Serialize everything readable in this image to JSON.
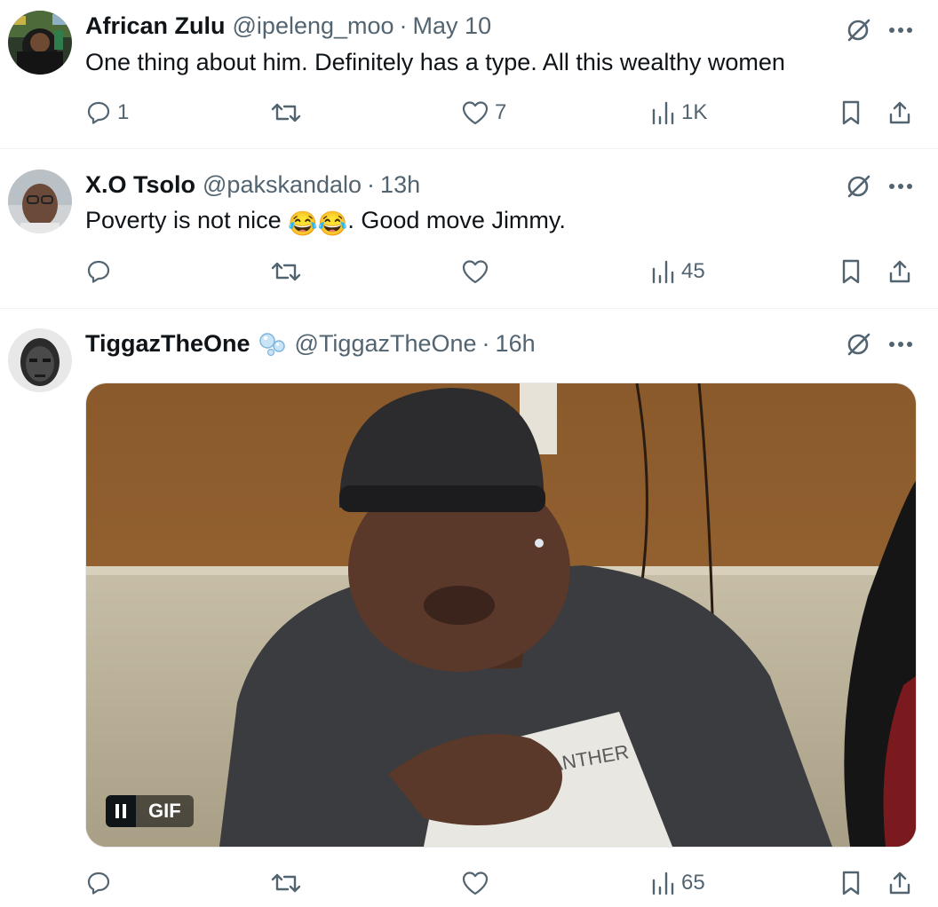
{
  "tweets": [
    {
      "name": "African Zulu",
      "handle": "@ipeleng_moo",
      "separator": "·",
      "time": "May 10",
      "text": "One thing about him. Definitely has a type. All this wealthy women",
      "replies": "1",
      "retweets": "",
      "likes": "7",
      "views": "1K"
    },
    {
      "name": "X.O Tsolo",
      "handle": "@pakskandalo",
      "separator": "·",
      "time": "13h",
      "text_before": "Poverty is not nice ",
      "text_emoji": "😂😂",
      "text_after": ". Good move Jimmy.",
      "replies": "",
      "retweets": "",
      "likes": "",
      "views": "45"
    },
    {
      "name": "TiggazTheOne",
      "badge_icon": "bubbles-icon",
      "handle": "@TiggazTheOne",
      "separator": "·",
      "time": "16h",
      "media": {
        "type": "gif",
        "label": "GIF",
        "shirt_text": "PANTHER"
      },
      "replies": "",
      "retweets": "",
      "likes": "",
      "views": "65"
    }
  ],
  "colors": {
    "text": "#0f1419",
    "secondary": "#536471",
    "divider": "#eff3f4"
  }
}
